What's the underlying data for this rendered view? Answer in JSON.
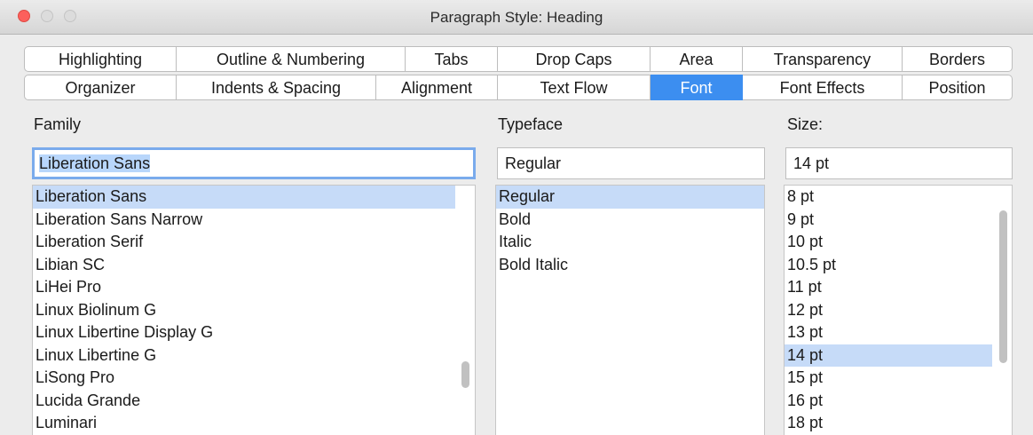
{
  "window": {
    "title": "Paragraph Style: Heading"
  },
  "tabs": {
    "row1": [
      "Highlighting",
      "Outline & Numbering",
      "Tabs",
      "Drop Caps",
      "Area",
      "Transparency",
      "Borders"
    ],
    "row2": [
      "Organizer",
      "Indents & Spacing",
      "Alignment",
      "Text Flow",
      "Font",
      "Font Effects",
      "Position"
    ],
    "selected": "Font"
  },
  "family": {
    "label": "Family",
    "value": "Liberation Sans",
    "items": [
      "Liberation Sans",
      "Liberation Sans Narrow",
      "Liberation Serif",
      "Libian SC",
      "LiHei Pro",
      "Linux Biolinum G",
      "Linux Libertine Display G",
      "Linux Libertine G",
      "LiSong Pro",
      "Lucida Grande",
      "Luminari"
    ],
    "selected_item": "Liberation Sans"
  },
  "typeface": {
    "label": "Typeface",
    "value": "Regular",
    "items": [
      "Regular",
      "Bold",
      "Italic",
      "Bold Italic"
    ],
    "selected_item": "Regular"
  },
  "size": {
    "label": "Size:",
    "value": "14 pt",
    "items": [
      "8 pt",
      "9 pt",
      "10 pt",
      "10.5 pt",
      "11 pt",
      "12 pt",
      "13 pt",
      "14 pt",
      "15 pt",
      "16 pt",
      "18 pt"
    ],
    "selected_item": "14 pt"
  },
  "colors": {
    "accent": "#3c8ef0",
    "selection": "#c6dbf8"
  }
}
